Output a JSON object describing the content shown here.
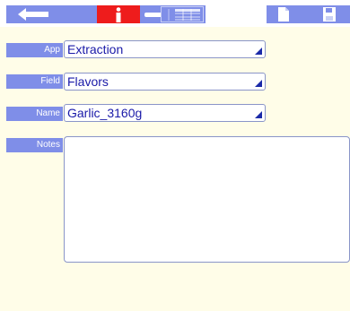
{
  "toolbar": {
    "icons": [
      "back-arrow-icon",
      "info-icon",
      "wrench-icon",
      "table-icon",
      "document-icon",
      "save-disk-icon"
    ],
    "active_color": "#ee1c1c",
    "accent_color": "#7f8ee8"
  },
  "form": {
    "app": {
      "label": "App",
      "value": "Extraction"
    },
    "field": {
      "label": "Field",
      "value": "Flavors"
    },
    "name": {
      "label": "Name",
      "value": "Garlic_3160g"
    },
    "notes": {
      "label": "Notes",
      "value": ""
    }
  }
}
